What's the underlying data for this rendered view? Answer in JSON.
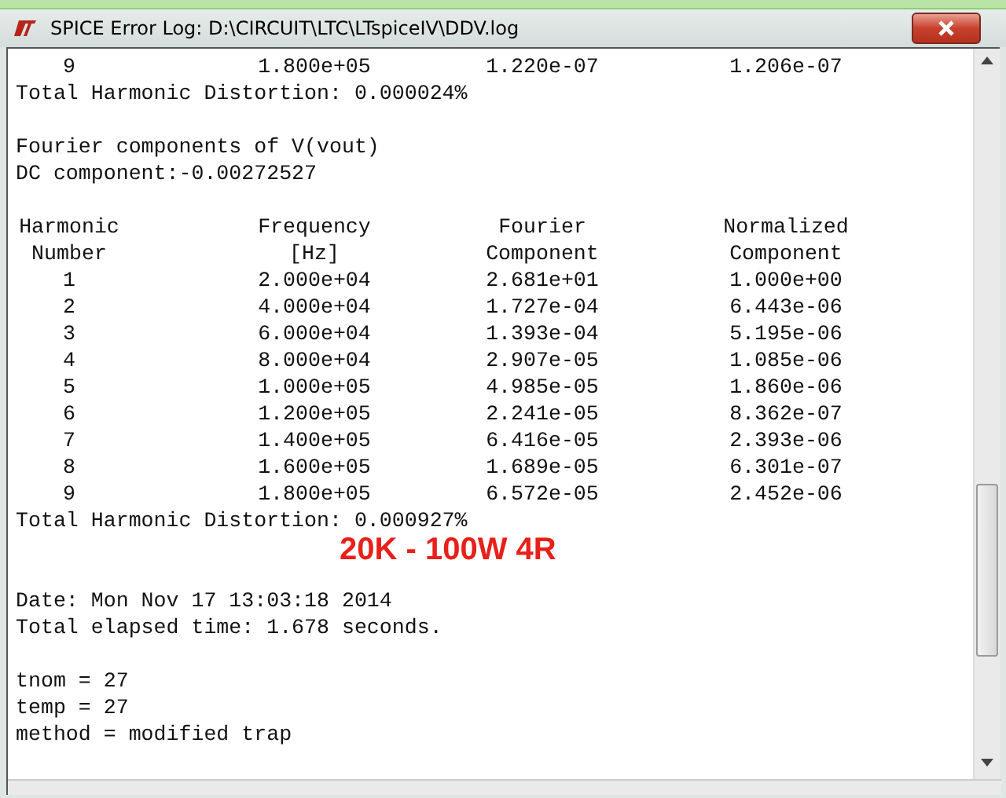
{
  "window": {
    "title": "SPICE Error Log: D:\\CIRCUIT\\LTC\\LTspiceIV\\DDV.log"
  },
  "log": [
    {
      "kind": "row",
      "cells": [
        "9",
        "1.800e+05",
        "1.220e-07",
        "1.206e-07"
      ]
    },
    {
      "kind": "line",
      "text": "Total Harmonic Distortion: 0.000024%"
    },
    {
      "kind": "blank"
    },
    {
      "kind": "line",
      "text": "Fourier components of V(vout)"
    },
    {
      "kind": "line",
      "text": "DC component:-0.00272527"
    },
    {
      "kind": "blank"
    },
    {
      "kind": "row",
      "cells": [
        "Harmonic",
        "Frequency",
        "Fourier",
        "Normalized"
      ]
    },
    {
      "kind": "row",
      "cells": [
        "Number",
        "[Hz]",
        "Component",
        "Component"
      ]
    },
    {
      "kind": "row",
      "cells": [
        "1",
        "2.000e+04",
        "2.681e+01",
        "1.000e+00"
      ]
    },
    {
      "kind": "row",
      "cells": [
        "2",
        "4.000e+04",
        "1.727e-04",
        "6.443e-06"
      ]
    },
    {
      "kind": "row",
      "cells": [
        "3",
        "6.000e+04",
        "1.393e-04",
        "5.195e-06"
      ]
    },
    {
      "kind": "row",
      "cells": [
        "4",
        "8.000e+04",
        "2.907e-05",
        "1.085e-06"
      ]
    },
    {
      "kind": "row",
      "cells": [
        "5",
        "1.000e+05",
        "4.985e-05",
        "1.860e-06"
      ]
    },
    {
      "kind": "row",
      "cells": [
        "6",
        "1.200e+05",
        "2.241e-05",
        "8.362e-07"
      ]
    },
    {
      "kind": "row",
      "cells": [
        "7",
        "1.400e+05",
        "6.416e-05",
        "2.393e-06"
      ]
    },
    {
      "kind": "row",
      "cells": [
        "8",
        "1.600e+05",
        "1.689e-05",
        "6.301e-07"
      ]
    },
    {
      "kind": "row",
      "cells": [
        "9",
        "1.800e+05",
        "6.572e-05",
        "2.452e-06"
      ]
    },
    {
      "kind": "line",
      "text": "Total Harmonic Distortion: 0.000927%"
    },
    {
      "kind": "annotation",
      "text": "20K - 100W 4R"
    },
    {
      "kind": "blank"
    },
    {
      "kind": "line",
      "text": "Date: Mon Nov 17 13:03:18 2014"
    },
    {
      "kind": "line",
      "text": "Total elapsed time: 1.678 seconds."
    },
    {
      "kind": "blank"
    },
    {
      "kind": "line",
      "text": "tnom = 27"
    },
    {
      "kind": "line",
      "text": "temp = 27"
    },
    {
      "kind": "line",
      "text": "method = modified trap"
    }
  ]
}
